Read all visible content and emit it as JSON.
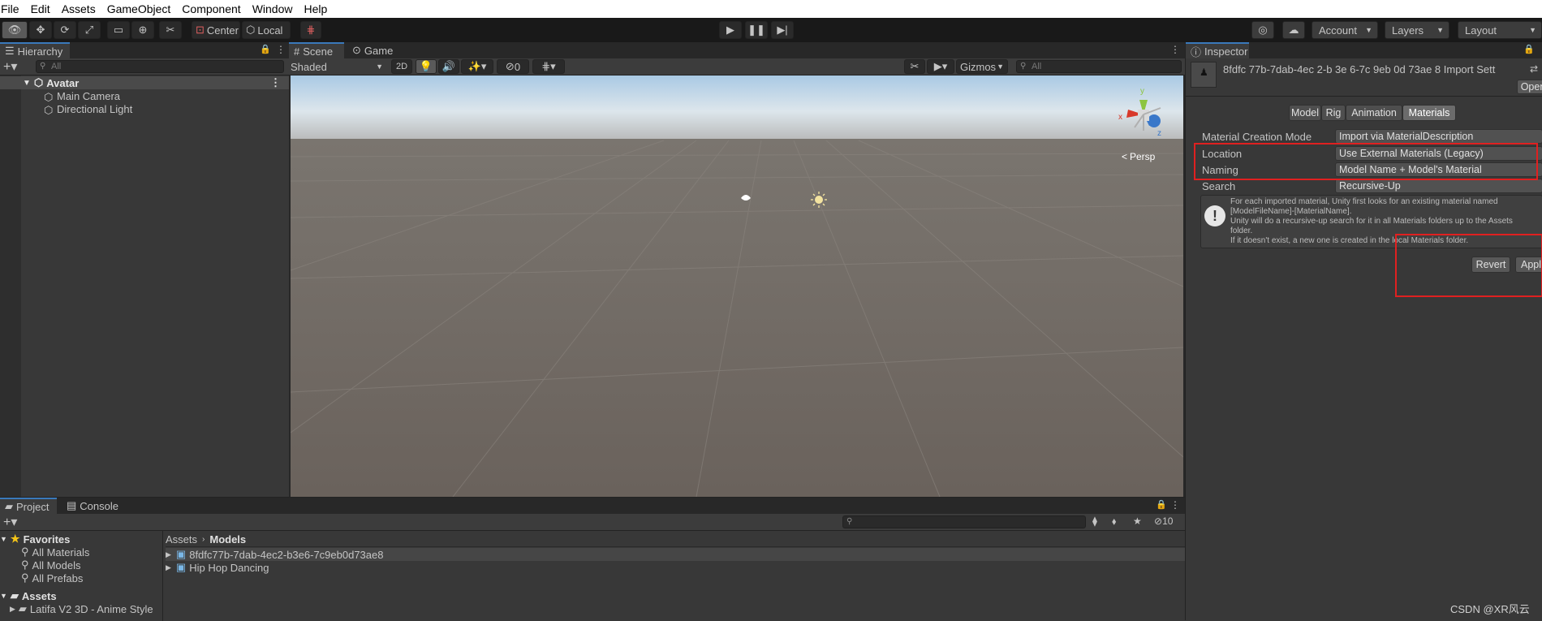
{
  "menu": [
    "File",
    "Edit",
    "Assets",
    "GameObject",
    "Component",
    "Window",
    "Help"
  ],
  "toolbar": {
    "center_label": "Center",
    "local_label": "Local",
    "account_label": "Account",
    "layers_label": "Layers",
    "layout_label": "Layout"
  },
  "hierarchy": {
    "tab_label": "Hierarchy",
    "search_placeholder": "All",
    "scene_name": "Avatar",
    "items": [
      "Main Camera",
      "Directional Light"
    ]
  },
  "scene": {
    "tabs": [
      "Scene",
      "Game"
    ],
    "shading_mode": "Shaded",
    "toggle_2d": "2D",
    "hidden_count": "0",
    "gizmos_label": "Gizmos",
    "search_placeholder": "All",
    "persp_label": "Persp",
    "gizmo_axes": [
      "y",
      "x",
      "z"
    ]
  },
  "inspector": {
    "tab_label": "Inspector",
    "title": "8fdfc 77b-7dab-4ec 2-b 3e 6-7c 9eb 0d 73ae 8 Import Sett",
    "open_label": "Open",
    "tabs": [
      "Model",
      "Rig",
      "Animation",
      "Materials"
    ],
    "active_tab": "Materials",
    "fields": [
      {
        "label": "Material Creation Mode",
        "value": "Import via MaterialDescription"
      },
      {
        "label": "Location",
        "value": "Use External Materials (Legacy)"
      },
      {
        "label": "Naming",
        "value": "Model Name + Model's Material"
      },
      {
        "label": "Search",
        "value": "Recursive-Up"
      }
    ],
    "help_lines": [
      "For each imported material, Unity first looks for an existing material named",
      "[ModelFileName]-[MaterialName].",
      "Unity will do a recursive-up search for it in all Materials folders up to the Assets",
      "folder.",
      "If it doesn't exist, a new one is created in the local Materials folder."
    ],
    "revert_label": "Revert",
    "apply_label": "Apply"
  },
  "project": {
    "tabs": [
      "Project",
      "Console"
    ],
    "hidden_count": "10",
    "favorites_label": "Favorites",
    "favorites": [
      "All Materials",
      "All Models",
      "All Prefabs"
    ],
    "assets_label": "Assets",
    "assets_children": [
      "Latifa V2 3D - Anime Style"
    ],
    "breadcrumb": [
      "Assets",
      "Models"
    ],
    "files": [
      "8fdfc77b-7dab-4ec2-b3e6-7c9eb0d73ae8",
      "Hip Hop Dancing"
    ]
  },
  "watermark": "CSDN @XR风云",
  "colors": {
    "accent": "#3a79bb",
    "highlight_box": "#e02020",
    "panel_bg": "#383838",
    "toolbar_bg": "#191919"
  }
}
